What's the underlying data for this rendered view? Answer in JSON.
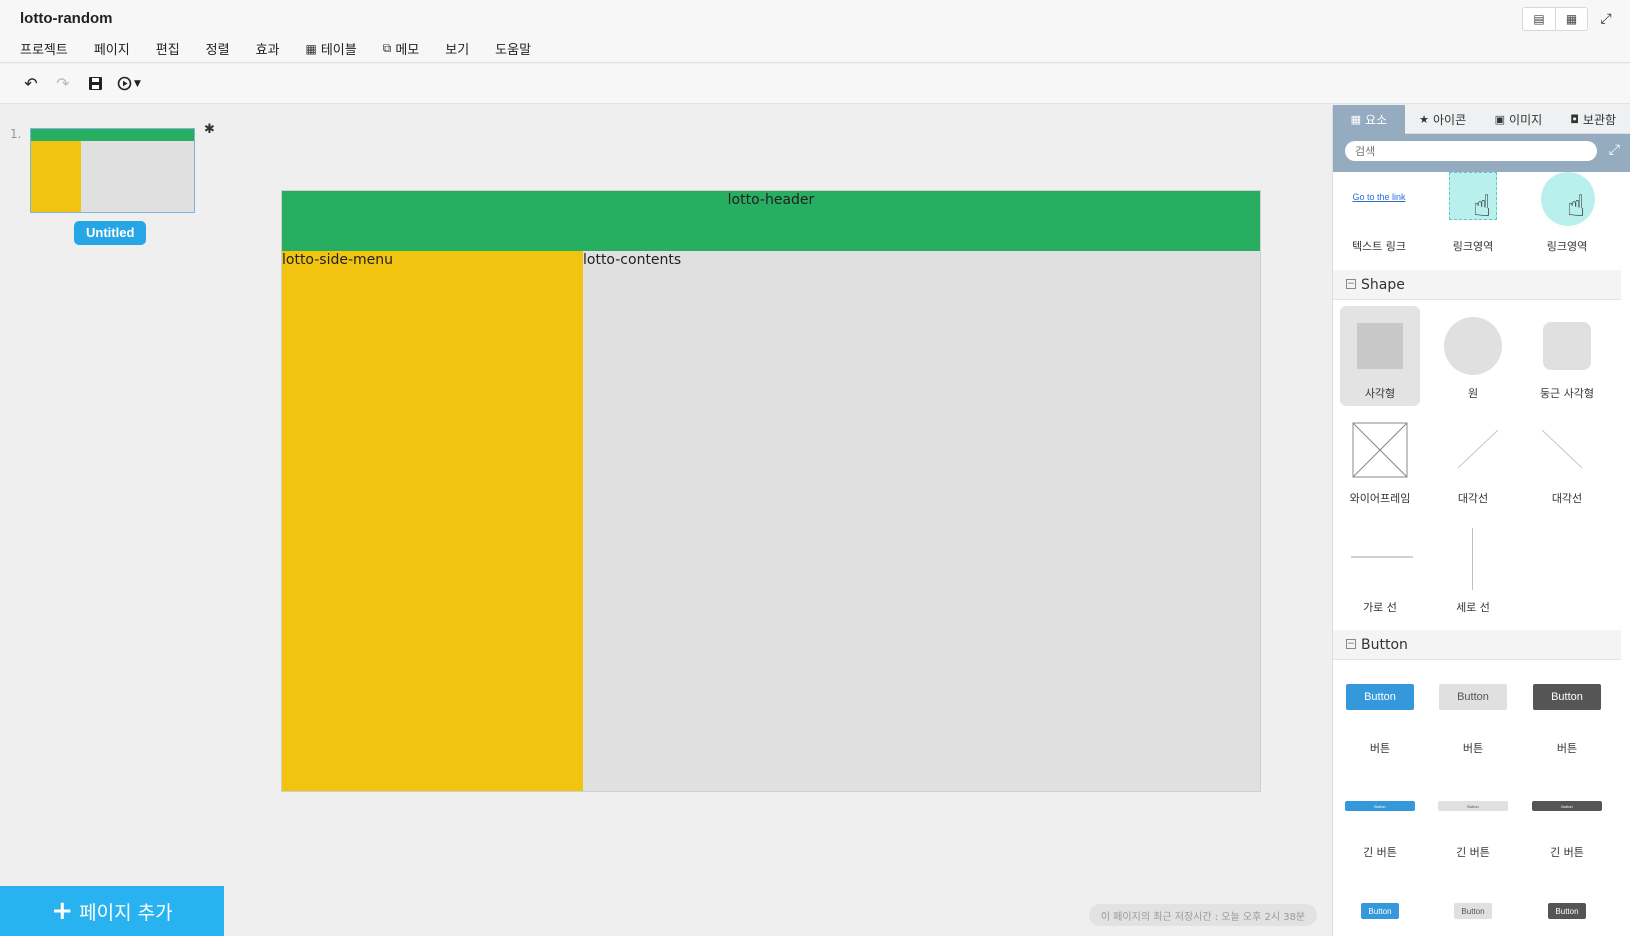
{
  "app": {
    "title": "lotto-random",
    "menu": [
      "프로젝트",
      "페이지",
      "편집",
      "정렬",
      "효과",
      "테이블",
      "메모",
      "보기",
      "도움말"
    ]
  },
  "page_list": {
    "page_number": "1.",
    "page_name": "Untitled",
    "add_page_label": "페이지 추가"
  },
  "canvas": {
    "header_label": "lotto-header",
    "side_menu_label": "lotto-side-menu",
    "contents_label": "lotto-contents",
    "colors": {
      "header": "#27ae60",
      "side_menu": "#f1c40f",
      "contents": "#e0e0e0"
    }
  },
  "status": {
    "save_text": "이 페이지의 최근 저장시간 : 오늘 오후 2시 38분"
  },
  "panel": {
    "tabs": [
      "요소",
      "아이콘",
      "이미지",
      "보관함"
    ],
    "search_placeholder": "검색",
    "links": {
      "text_link_sample": "Go to the link",
      "labels": [
        "텍스트 링크",
        "링크영역",
        "링크영역"
      ]
    },
    "shape_section": "Shape",
    "shapes": [
      "사각형",
      "원",
      "둥근 사각형",
      "와이어프레임",
      "대각선",
      "대각선",
      "가로 선",
      "세로 선"
    ],
    "button_section": "Button",
    "button_sample": "Button",
    "buttons": [
      "버튼",
      "버튼",
      "버튼"
    ],
    "long_buttons": [
      "긴 버튼",
      "긴 버튼",
      "긴 버튼"
    ]
  }
}
